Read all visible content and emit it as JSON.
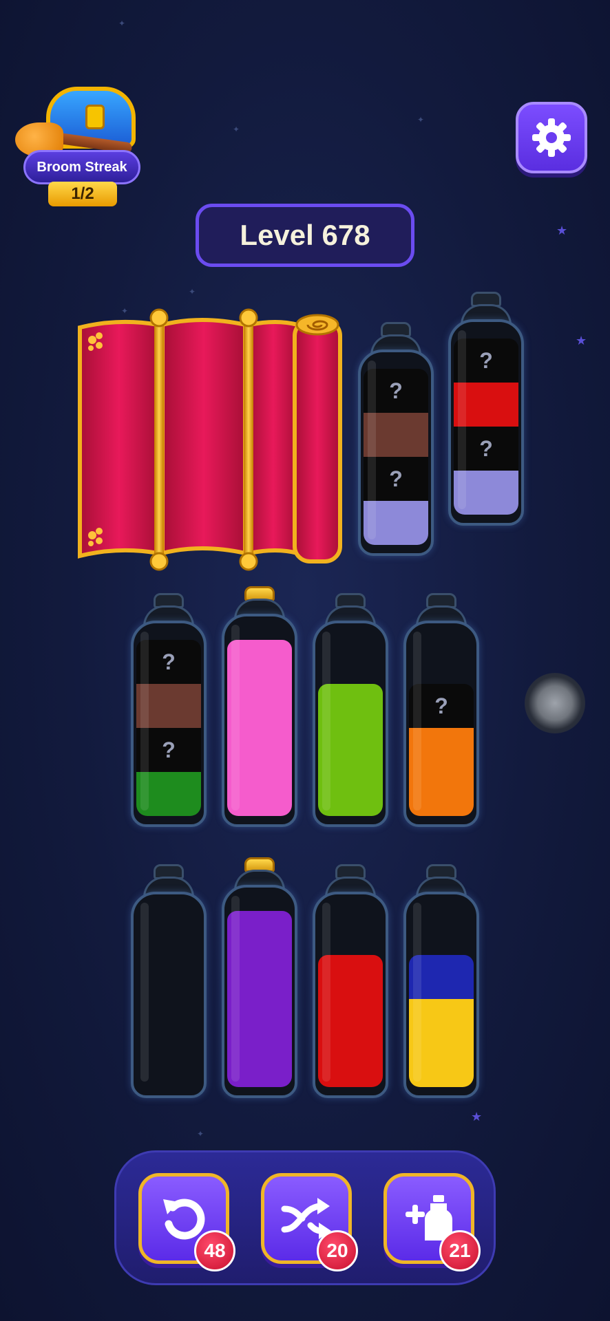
{
  "streak": {
    "label": "Broom Streak",
    "progress": "1/2"
  },
  "level": {
    "label": "Level 678"
  },
  "settings": {
    "icon": "gear-icon"
  },
  "colors": {
    "lavender": "#8d89d9",
    "black": "#0a0a0a",
    "brown": "#6b3a30",
    "red": "#d90f10",
    "green": "#1e8c1e",
    "pink": "#f55ccc",
    "lime": "#6fbf10",
    "orange": "#f2760c",
    "purple": "#7a1fc9",
    "yellow": "#f7c816",
    "blue": "#1e27b0"
  },
  "bottles": [
    {
      "id": "b1",
      "cork": false,
      "layers": [
        {
          "color": "lavender",
          "hidden": false
        },
        {
          "color": "black",
          "hidden": true,
          "label": "?"
        },
        {
          "color": "brown",
          "hidden": false
        },
        {
          "color": "black",
          "hidden": true,
          "label": "?"
        }
      ]
    },
    {
      "id": "b2",
      "cork": false,
      "layers": [
        {
          "color": "lavender",
          "hidden": false
        },
        {
          "color": "black",
          "hidden": true,
          "label": "?"
        },
        {
          "color": "red",
          "hidden": false
        },
        {
          "color": "black",
          "hidden": true,
          "label": "?"
        }
      ]
    },
    {
      "id": "b3",
      "cork": false,
      "layers": [
        {
          "color": "green",
          "hidden": false
        },
        {
          "color": "black",
          "hidden": true,
          "label": "?"
        },
        {
          "color": "brown",
          "hidden": false
        },
        {
          "color": "black",
          "hidden": true,
          "label": "?"
        }
      ]
    },
    {
      "id": "b4",
      "cork": true,
      "layers": [
        {
          "color": "pink",
          "hidden": false
        },
        {
          "color": "pink",
          "hidden": false
        },
        {
          "color": "pink",
          "hidden": false
        },
        {
          "color": "pink",
          "hidden": false
        }
      ]
    },
    {
      "id": "b5",
      "cork": false,
      "layers": [
        {
          "color": "lime",
          "hidden": false
        },
        {
          "color": "lime",
          "hidden": false
        },
        {
          "color": "lime",
          "hidden": false
        }
      ]
    },
    {
      "id": "b6",
      "cork": false,
      "layers": [
        {
          "color": "orange",
          "hidden": false
        },
        {
          "color": "orange",
          "hidden": false
        },
        {
          "color": "black",
          "hidden": true,
          "label": "?"
        }
      ]
    },
    {
      "id": "b7",
      "cork": false,
      "layers": []
    },
    {
      "id": "b8",
      "cork": true,
      "layers": [
        {
          "color": "purple",
          "hidden": false
        },
        {
          "color": "purple",
          "hidden": false
        },
        {
          "color": "purple",
          "hidden": false
        },
        {
          "color": "purple",
          "hidden": false
        }
      ]
    },
    {
      "id": "b9",
      "cork": false,
      "layers": [
        {
          "color": "red",
          "hidden": false
        },
        {
          "color": "red",
          "hidden": false
        },
        {
          "color": "red",
          "hidden": false
        }
      ]
    },
    {
      "id": "b10",
      "cork": false,
      "layers": [
        {
          "color": "yellow",
          "hidden": false
        },
        {
          "color": "yellow",
          "hidden": false
        },
        {
          "color": "blue",
          "hidden": false
        }
      ]
    }
  ],
  "toolbar": {
    "undo": {
      "icon": "undo-icon",
      "count": "48"
    },
    "shuffle": {
      "icon": "shuffle-icon",
      "count": "20"
    },
    "add_bottle": {
      "icon": "add-bottle-icon",
      "count": "21"
    }
  }
}
